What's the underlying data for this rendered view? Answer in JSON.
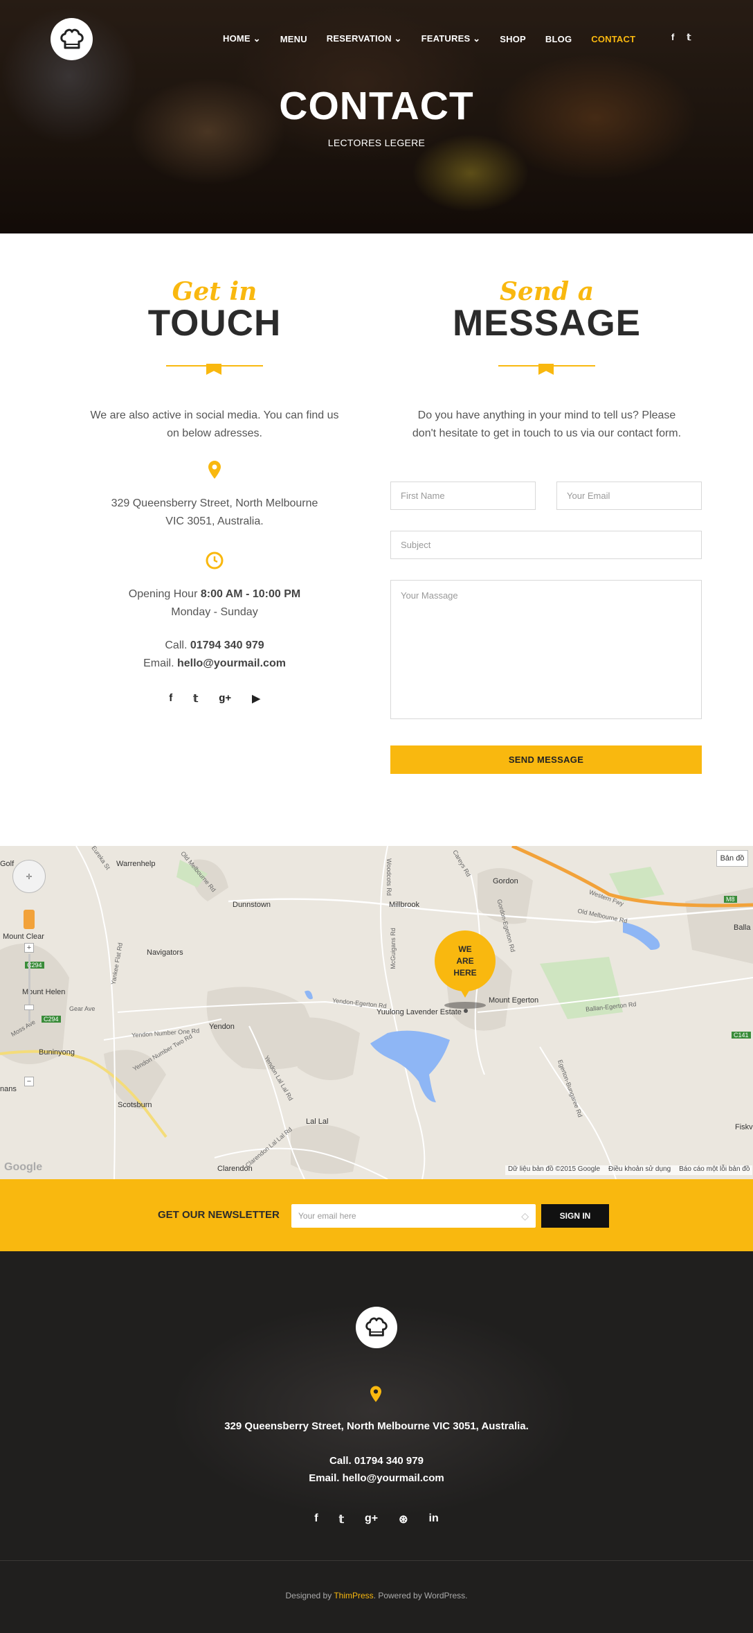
{
  "header": {
    "nav": [
      "HOME",
      "MENU",
      "RESERVATION",
      "FEATURES",
      "SHOP",
      "BLOG",
      "CONTACT"
    ],
    "social": [
      "f",
      "𝕥"
    ],
    "title": "CONTACT",
    "subtitle": "LECTORES LEGERE"
  },
  "touch": {
    "script": "Get in",
    "big": "TOUCH",
    "intro_1": "We are also active in social media. You can find us",
    "intro_2": "on below adresses.",
    "address_1": "329 Queensberry Street, North Melbourne",
    "address_2": "VIC 3051, Australia.",
    "hours_label": "Opening Hour",
    "hours_value": "8:00 AM - 10:00 PM",
    "days": "Monday - Sunday",
    "call_label": "Call.",
    "call_value": "01794 340 979",
    "email_label": "Email.",
    "email_value": "hello@yourmail.com",
    "social": [
      "f",
      "𝕥",
      "g+",
      "▶"
    ]
  },
  "message": {
    "script": "Send a",
    "big": "MESSAGE",
    "intro_1": "Do you have anything in your mind to tell us? Please",
    "intro_2": "don't hesitate to get in touch to us via our contact form.",
    "first_name": "First Name",
    "email": "Your Email",
    "subject": "Subject",
    "massage": "Your Massage",
    "send": "SEND MESSAGE"
  },
  "map": {
    "marker": [
      "WE",
      "ARE",
      "HERE"
    ],
    "map_button": "Bản đồ",
    "places": [
      "Golf",
      "Warrenhelp",
      "Dunnstown",
      "Millbrook",
      "Gordon",
      "Balla",
      "Mount Clear",
      "Navigators",
      "Mount Helen",
      "Yendon",
      "Yuulong Lavender Estate",
      "Mount Egerton",
      "Buninyong",
      "Scotsburn",
      "Lal Lal",
      "Clarendon",
      "Fiskv",
      "nans"
    ],
    "roads": [
      "Western Fwy",
      "Old Melbourne Rd",
      "Yendon-Egerton Rd",
      "Ballan-Egerton Rd",
      "Yendon Number One Rd",
      "Yendon Number Two Rd",
      "Yendon Lal Lal Rd",
      "Clarendon Lal Lal Rd",
      "Egerton-Bungaree Rd",
      "McGuigans Rd",
      "Woodcots Rd",
      "Gordon-Egerton Rd",
      "Gear Ave",
      "Yankee Flat Rd",
      "Eureka St",
      "Old Melbourne Rd",
      "Careys Rd",
      "Moss Ave"
    ],
    "shields": [
      "M8",
      "C294",
      "C294",
      "C141"
    ],
    "google": "Google",
    "attribution": "Dữ liệu bản đồ ©2015 Google",
    "terms": "Điều khoản sử dụng",
    "report": "Báo cáo một lỗi bản đồ"
  },
  "newsletter": {
    "label": "GET OUR NEWSLETTER",
    "placeholder": "Your email here",
    "button": "SIGN IN"
  },
  "footer": {
    "address": "329 Queensberry Street, North Melbourne VIC 3051, Australia.",
    "call": "Call. 01794 340 979",
    "email": "Email. hello@yourmail.com",
    "social": [
      "f",
      "𝕥",
      "g+",
      "⊛",
      "in"
    ],
    "designed_by": "Designed by",
    "thimpress": "ThimPress",
    "powered": ". Powered by WordPress."
  },
  "colors": {
    "accent": "#f9b80f",
    "dark": "#2b2b2b",
    "footer": "#201f1e"
  }
}
